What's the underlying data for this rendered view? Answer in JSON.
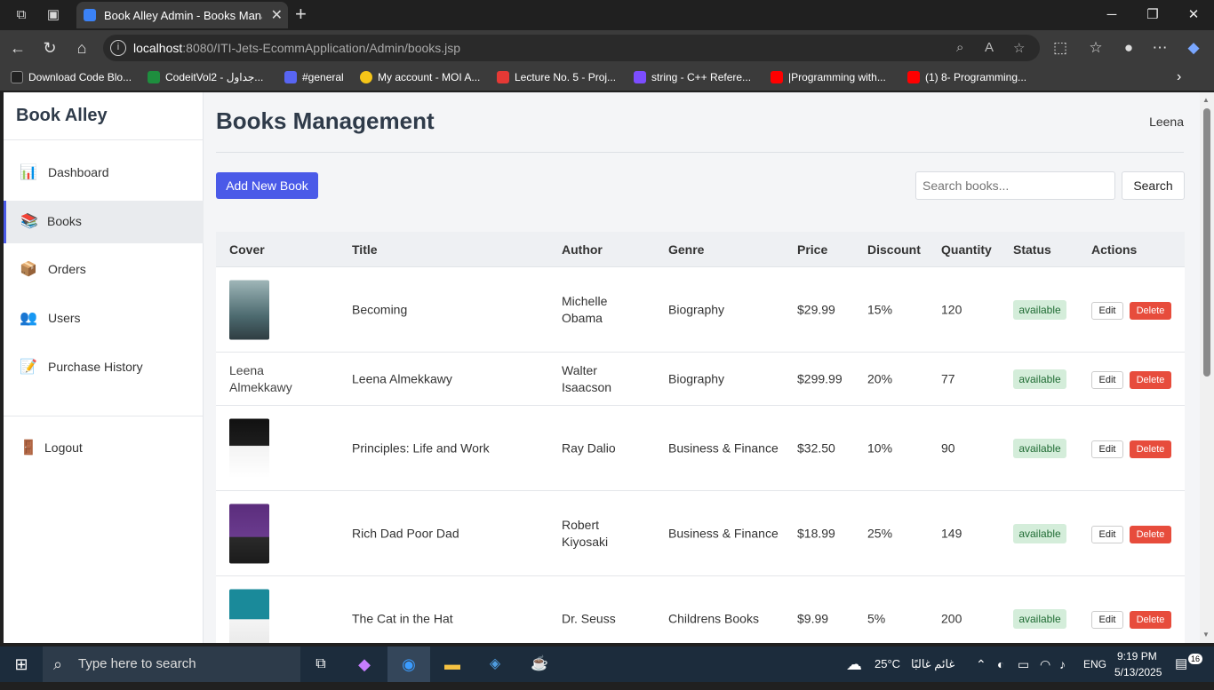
{
  "browser": {
    "tab_title": "Book Alley Admin - Books Management",
    "url_host": "localhost",
    "url_rest": ":8080/ITI-Jets-EcommApplication/Admin/books.jsp",
    "bookmarks": [
      {
        "label": "Download Code Blo...",
        "color": "#222222"
      },
      {
        "label": "CodeitVol2 - جداول...",
        "color": "#1e8e3e"
      },
      {
        "label": "#general",
        "color": "#5865f2"
      },
      {
        "label": "My account - MOI A...",
        "color": "#111111"
      },
      {
        "label": "Lecture No. 5 - Proj...",
        "color": "#e53935"
      },
      {
        "label": "string - C++ Refere...",
        "color": "#7c4dff"
      },
      {
        "label": "|Programming with...",
        "color": "#ff0000"
      },
      {
        "label": "(1) 8- Programming...",
        "color": "#ff0000"
      }
    ]
  },
  "sidebar": {
    "brand": "Book Alley",
    "items": [
      {
        "label": "Dashboard",
        "icon": "chart-icon",
        "glyph": "📊"
      },
      {
        "label": "Books",
        "icon": "books-icon",
        "glyph": "📚"
      },
      {
        "label": "Orders",
        "icon": "package-icon",
        "glyph": "📦"
      },
      {
        "label": "Users",
        "icon": "users-icon",
        "glyph": "👥"
      },
      {
        "label": "Purchase History",
        "icon": "memo-icon",
        "glyph": "📝"
      }
    ],
    "logout": {
      "label": "Logout",
      "icon": "door-icon",
      "glyph": "🚪"
    }
  },
  "header": {
    "title": "Books Management",
    "user": "Leena"
  },
  "toolbar": {
    "add_label": "Add New Book",
    "search_placeholder": "Search books...",
    "search_label": "Search"
  },
  "table": {
    "columns": [
      "Cover",
      "Title",
      "Author",
      "Genre",
      "Price",
      "Discount",
      "Quantity",
      "Status",
      "Actions"
    ],
    "edit_label": "Edit",
    "delete_label": "Delete",
    "rows": [
      {
        "cover_color": "#6f8a8e",
        "cover_alt": "",
        "title": "Becoming",
        "author": "Michelle Obama",
        "genre": "Biography",
        "price": "$29.99",
        "discount": "15%",
        "quantity": "120",
        "status": "available"
      },
      {
        "cover_color": "",
        "cover_alt": "Leena Almekkawy",
        "title": "Leena Almekkawy",
        "author": "Walter Isaacson",
        "genre": "Biography",
        "price": "$299.99",
        "discount": "20%",
        "quantity": "77",
        "status": "available"
      },
      {
        "cover_color": "#1d1d1d",
        "cover_alt": "",
        "title": "Principles: Life and Work",
        "author": "Ray Dalio",
        "genre": "Business & Finance",
        "price": "$32.50",
        "discount": "10%",
        "quantity": "90",
        "status": "available"
      },
      {
        "cover_color": "#5b2d7c",
        "cover_alt": "",
        "title": "Rich Dad Poor Dad",
        "author": "Robert Kiyosaki",
        "genre": "Business & Finance",
        "price": "$18.99",
        "discount": "25%",
        "quantity": "149",
        "status": "available"
      },
      {
        "cover_color": "#1a8a9a",
        "cover_alt": "",
        "title": "The Cat in the Hat",
        "author": "Dr. Seuss",
        "genre": "Childrens Books",
        "price": "$9.99",
        "discount": "5%",
        "quantity": "200",
        "status": "available"
      }
    ]
  },
  "taskbar": {
    "search_placeholder": "Type here to search",
    "weather": "25°C",
    "weather_text": "غائم غالبًا",
    "lang": "ENG",
    "time": "9:19 PM",
    "date": "5/13/2025",
    "notifications": "16"
  }
}
